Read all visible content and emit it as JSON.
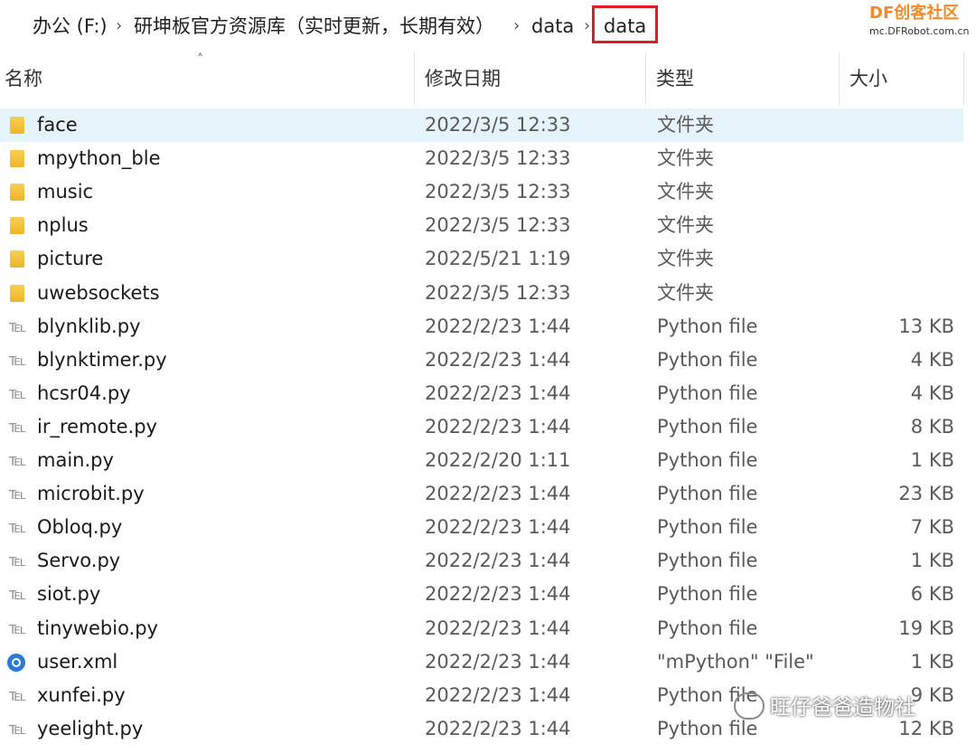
{
  "breadcrumb": {
    "items": [
      "办公 (F:)",
      "研坤板官方资源库（实时更新，长期有效）",
      "data",
      "data"
    ]
  },
  "logo": {
    "prefix": "DF",
    "name": "创客社区",
    "url": "mc.DFRobot.com.cn"
  },
  "columns": {
    "name": "名称",
    "date": "修改日期",
    "type": "类型",
    "size": "大小"
  },
  "rows": [
    {
      "name": "face",
      "date": "2022/3/5 12:33",
      "type": "文件夹",
      "size": "",
      "icon": "folder-icon"
    },
    {
      "name": "mpython_ble",
      "date": "2022/3/5 12:33",
      "type": "文件夹",
      "size": "",
      "icon": "folder-icon"
    },
    {
      "name": "music",
      "date": "2022/3/5 12:33",
      "type": "文件夹",
      "size": "",
      "icon": "folder-icon"
    },
    {
      "name": "nplus",
      "date": "2022/3/5 12:33",
      "type": "文件夹",
      "size": "",
      "icon": "folder-icon"
    },
    {
      "name": "picture",
      "date": "2022/5/21 1:19",
      "type": "文件夹",
      "size": "",
      "icon": "folder-icon"
    },
    {
      "name": "uwebsockets",
      "date": "2022/3/5 12:33",
      "type": "文件夹",
      "size": "",
      "icon": "folder-icon"
    },
    {
      "name": "blynklib.py",
      "date": "2022/2/23 1:44",
      "type": "Python file",
      "size": "13 KB",
      "icon": "python-file-icon"
    },
    {
      "name": "blynktimer.py",
      "date": "2022/2/23 1:44",
      "type": "Python file",
      "size": "4 KB",
      "icon": "python-file-icon"
    },
    {
      "name": "hcsr04.py",
      "date": "2022/2/23 1:44",
      "type": "Python file",
      "size": "4 KB",
      "icon": "python-file-icon"
    },
    {
      "name": "ir_remote.py",
      "date": "2022/2/23 1:44",
      "type": "Python file",
      "size": "8 KB",
      "icon": "python-file-icon"
    },
    {
      "name": "main.py",
      "date": "2022/2/20 1:11",
      "type": "Python file",
      "size": "1 KB",
      "icon": "python-file-icon"
    },
    {
      "name": "microbit.py",
      "date": "2022/2/23 1:44",
      "type": "Python file",
      "size": "23 KB",
      "icon": "python-file-icon"
    },
    {
      "name": "Obloq.py",
      "date": "2022/2/23 1:44",
      "type": "Python file",
      "size": "7 KB",
      "icon": "python-file-icon"
    },
    {
      "name": "Servo.py",
      "date": "2022/2/23 1:44",
      "type": "Python file",
      "size": "1 KB",
      "icon": "python-file-icon"
    },
    {
      "name": "siot.py",
      "date": "2022/2/23 1:44",
      "type": "Python file",
      "size": "6 KB",
      "icon": "python-file-icon"
    },
    {
      "name": "tinywebio.py",
      "date": "2022/2/23 1:44",
      "type": "Python file",
      "size": "19 KB",
      "icon": "python-file-icon"
    },
    {
      "name": "user.xml",
      "date": "2022/2/23 1:44",
      "type": "\"mPython\" \"File\"",
      "size": "1 KB",
      "icon": "mpython-file-icon"
    },
    {
      "name": "xunfei.py",
      "date": "2022/2/23 1:44",
      "type": "Python file",
      "size": "9 KB",
      "icon": "python-file-icon"
    },
    {
      "name": "yeelight.py",
      "date": "2022/2/23 1:44",
      "type": "Python file",
      "size": "12 KB",
      "icon": "python-file-icon"
    }
  ],
  "selected_row": 0,
  "watermark": {
    "text": "旺仔爸爸造物社"
  },
  "colors": {
    "selection": "#e5f3fb",
    "highlight_border": "#e11b22",
    "folder": "#f0b429",
    "logo": "#f08a2a"
  }
}
